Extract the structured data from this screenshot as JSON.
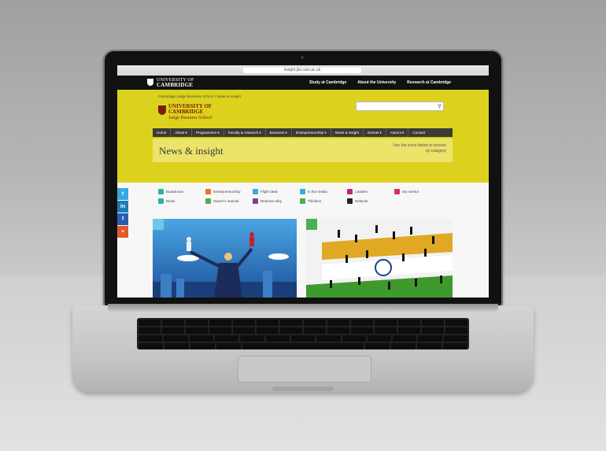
{
  "browser": {
    "url": "insight.jbs.cam.ac.uk"
  },
  "university": {
    "logo_line1": "UNIVERSITY OF",
    "logo_line2": "CAMBRIDGE",
    "nav": [
      "Study at Cambridge",
      "About the University",
      "Research at Cambridge"
    ]
  },
  "breadcrumb": "Cambridge Judge Business School  >  News & insight",
  "school": {
    "line1": "UNIVERSITY OF",
    "line2": "CAMBRIDGE",
    "line3": "Judge Business School"
  },
  "mainnav": [
    "Home",
    "About ▾",
    "Programmes ▾",
    "Faculty & research ▾",
    "Business ▾",
    "Entrepreneurship ▾",
    "News & insight",
    "Events ▾",
    "Alumni ▾",
    "Contact"
  ],
  "page": {
    "title": "News & insight",
    "subtitle": "Use the icons below to browse by category"
  },
  "categories": [
    {
      "label": "Boardroom",
      "color": "#2bb3a6"
    },
    {
      "label": "Entrepreneurship",
      "color": "#e8732a"
    },
    {
      "label": "Flight desk",
      "color": "#3aaedb"
    },
    {
      "label": "In the media",
      "color": "#3aaedb"
    },
    {
      "label": "Leaders",
      "color": "#c0267a"
    },
    {
      "label": "My mentor",
      "color": "#d6335a"
    },
    {
      "label": "News",
      "color": "#2bb3a6"
    },
    {
      "label": "Owner's manual",
      "color": "#4caf50"
    },
    {
      "label": "Reasons why",
      "color": "#7b3fa0"
    },
    {
      "label": "Thinkers",
      "color": "#4caf50"
    },
    {
      "label": "Network",
      "color": "#222222"
    }
  ],
  "social": [
    {
      "glyph": "t",
      "color": "#34a9e0"
    },
    {
      "glyph": "in",
      "color": "#1f7bb6"
    },
    {
      "glyph": "f",
      "color": "#2a5db0"
    },
    {
      "glyph": "+",
      "color": "#e05a2b"
    }
  ]
}
